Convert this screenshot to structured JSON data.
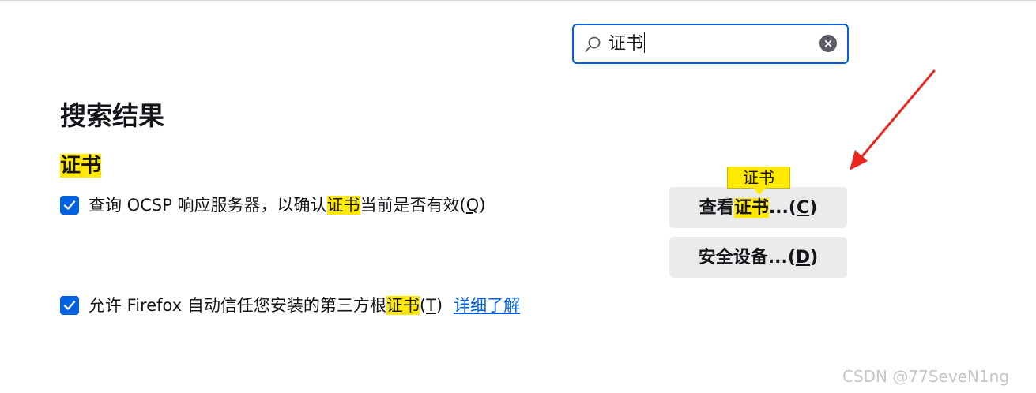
{
  "search": {
    "value": "证书"
  },
  "results": {
    "heading": "搜索结果",
    "section_title": "证书"
  },
  "ocsp_option": {
    "checked": true,
    "label_before": "查询 OCSP 响应服务器，以确认",
    "label_highlight": "证书",
    "label_after_a": "当前是否有效(",
    "accesskey": "Q",
    "label_after_b": ")"
  },
  "root_cert_option": {
    "checked": true,
    "label_before": "允许 Firefox 自动信任您安装的第三方根",
    "label_highlight": "证书",
    "label_after_a": "(",
    "accesskey": "T",
    "label_after_b": ")",
    "learn_more": "详细了解"
  },
  "buttons": {
    "view_certs": {
      "prefix": "查看",
      "highlight": "证书",
      "suffix": "...(",
      "accesskey": "C",
      "close": ")"
    },
    "security_devices": {
      "label": "安全设备...(",
      "accesskey": "D",
      "close": ")"
    }
  },
  "tooltip": {
    "text": "证书"
  },
  "watermark": "CSDN @77SeveN1ng",
  "colors": {
    "accent": "#0061e0",
    "highlight": "#ffe900",
    "annotation": "#e8281e",
    "button_bg": "#ebebeb"
  }
}
